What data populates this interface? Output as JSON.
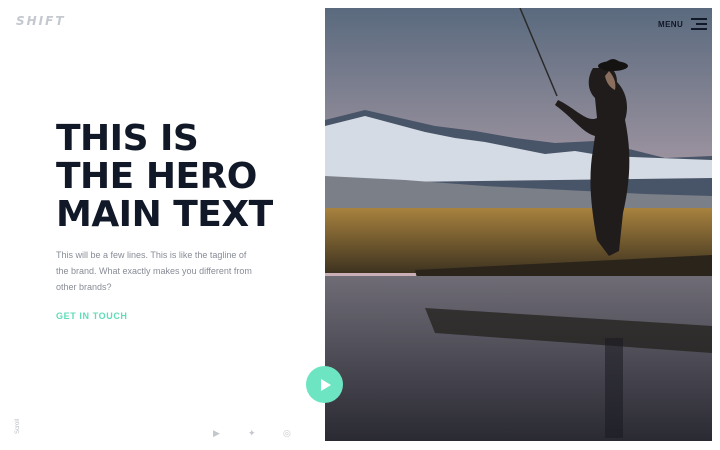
{
  "brand": {
    "logo_text": "SHIFT"
  },
  "nav": {
    "menu_label": "MENU"
  },
  "hero": {
    "title_lines": [
      {
        "plain": "THIS IS",
        "highlight": ""
      },
      {
        "plain": "THE ",
        "highlight": "HERO"
      },
      {
        "highlight": "MAIN",
        "plain": " TEXT"
      }
    ],
    "tagline": "This will be a few lines. This is like the tagline of the brand. What exactly makes you different from other brands?",
    "cta_label": "GET IN TOUCH"
  },
  "scroll_label": "Scroll",
  "social": [
    {
      "icon": "youtube-icon",
      "glyph": "▶"
    },
    {
      "icon": "twitter-icon",
      "glyph": "🐦"
    },
    {
      "icon": "instagram-icon",
      "glyph": "◎"
    }
  ],
  "colors": {
    "accent": "#6ee5c2",
    "text": "#111827",
    "muted": "#888c96"
  }
}
